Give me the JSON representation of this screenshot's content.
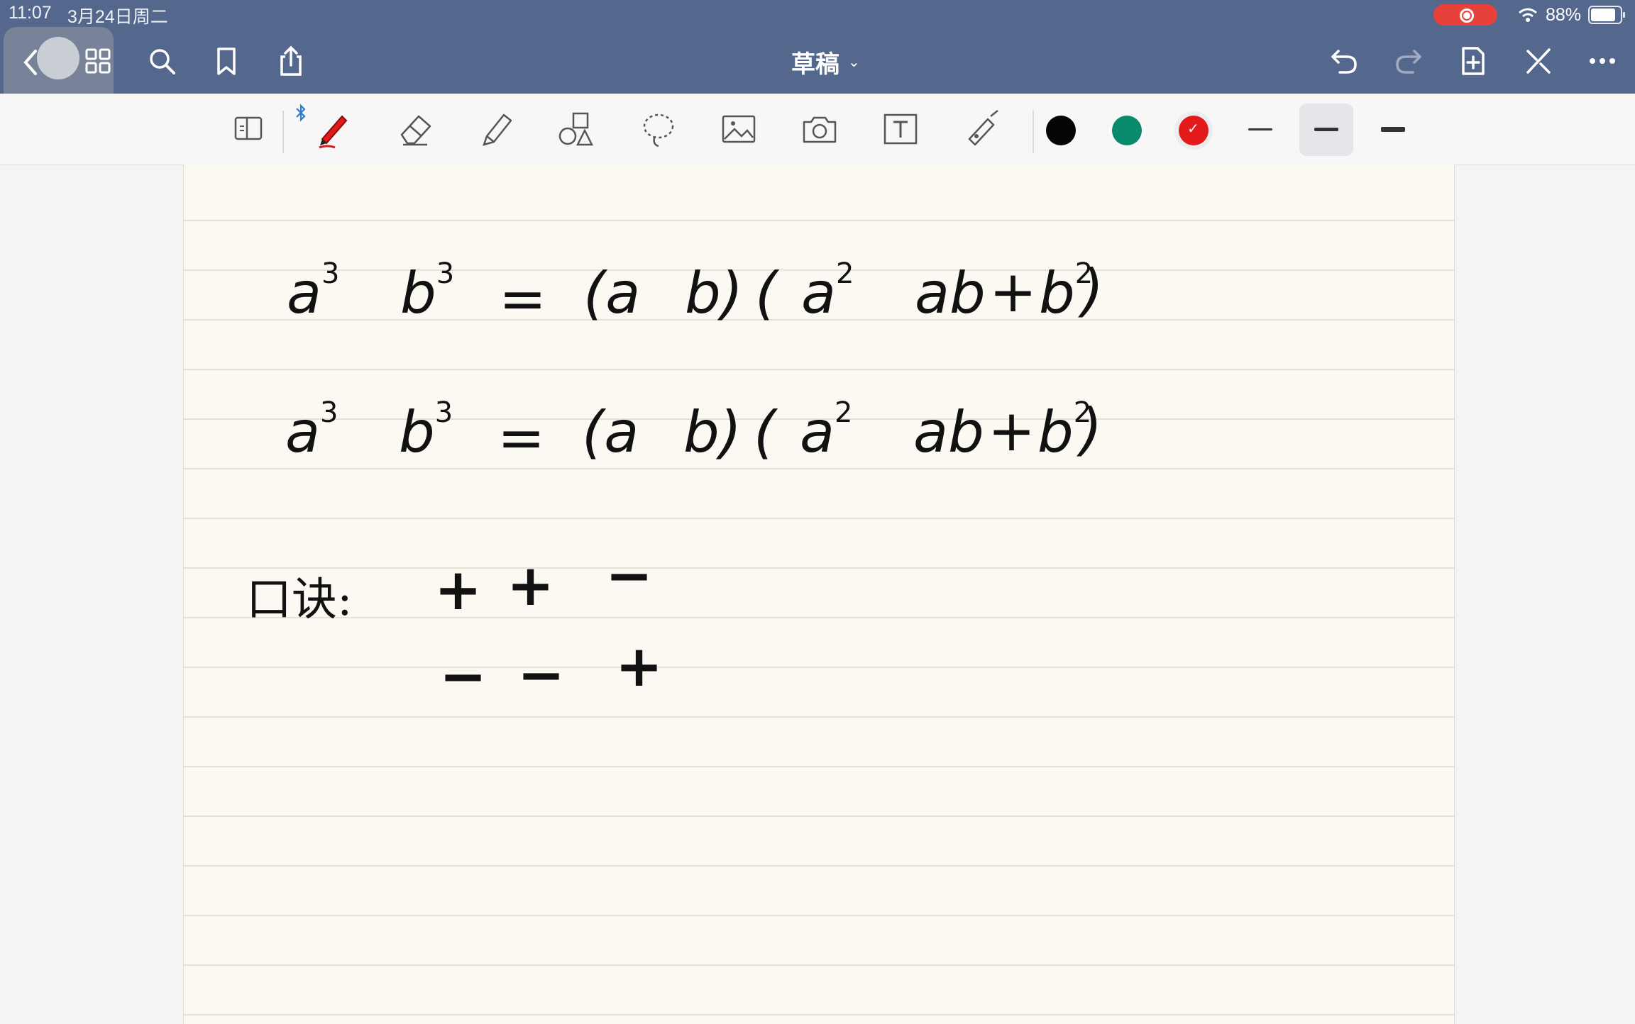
{
  "status": {
    "time": "11:07",
    "date": "3月24日周二",
    "battery": "88%"
  },
  "nav": {
    "title": "草稿",
    "accent": "#54678c"
  },
  "toolbar": {
    "colors": [
      "#050505",
      "#0a8a6c",
      "#e21a1a"
    ],
    "selected_color": "#e21a1a",
    "stroke_widths": [
      "thin",
      "medium",
      "thick"
    ],
    "selected_stroke": "medium"
  },
  "note": {
    "line1": {
      "left": "a",
      "left_exp": "3",
      "mid": "b",
      "mid_exp": "3",
      "eq": "=",
      "open1": "(a",
      "b1": "b)",
      "open2": "(",
      "a2": "a",
      "a2_exp": "2",
      "ab": "ab",
      "plus": "+",
      "b2": "b",
      "b2_exp": "2",
      "close": ")"
    },
    "line2": {
      "left": "a",
      "left_exp": "3",
      "mid": "b",
      "mid_exp": "3",
      "eq": "=",
      "open1": "(a",
      "b1": "b)",
      "open2": "(",
      "a2": "a",
      "a2_exp": "2",
      "ab": "ab",
      "plus": "+",
      "b2": "b",
      "b2_exp": "2",
      "close": ")"
    },
    "mnemonic_label": "口诀:",
    "row1_signs": [
      "+",
      "+",
      "−"
    ],
    "row2_signs": [
      "−",
      "−",
      "+"
    ]
  }
}
